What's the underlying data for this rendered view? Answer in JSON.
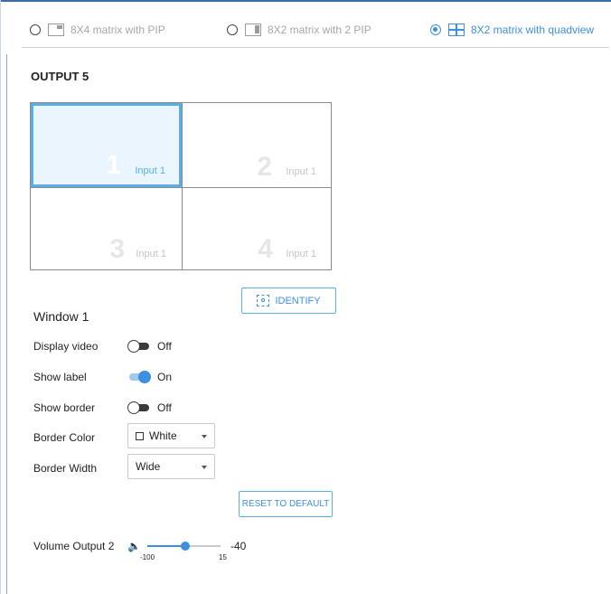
{
  "layout_modes": [
    {
      "label": "8X4 matrix with PIP",
      "selected": false
    },
    {
      "label": "8X2 matrix with 2 PIP",
      "selected": false
    },
    {
      "label": "8X2 matrix with quadview",
      "selected": true
    }
  ],
  "output": {
    "title": "OUTPUT 5"
  },
  "quadview": {
    "windows": [
      {
        "number": "1",
        "input": "Input 1",
        "selected": true
      },
      {
        "number": "2",
        "input": "Input 1",
        "selected": false
      },
      {
        "number": "3",
        "input": "Input 1",
        "selected": false
      },
      {
        "number": "4",
        "input": "Input 1",
        "selected": false
      }
    ]
  },
  "identify_button": {
    "label": "IDENTIFY"
  },
  "window_settings": {
    "title": "Window 1",
    "display_video": {
      "label": "Display video",
      "state": "Off"
    },
    "show_label": {
      "label": "Show label",
      "state": "On"
    },
    "show_border": {
      "label": "Show border",
      "state": "Off"
    },
    "border_color": {
      "label": "Border Color",
      "value": "White"
    },
    "border_width": {
      "label": "Border Width",
      "value": "Wide"
    }
  },
  "reset_button": {
    "label": "RESET TO DEFAULT"
  },
  "volume": {
    "label": "Volume Output 2",
    "min_label": "-100",
    "max_label": "15",
    "min": -100,
    "max": 15,
    "value": -40,
    "value_text": "-40"
  },
  "colors": {
    "accent": "#3d8fe0",
    "selected_cell_bg": "#eaf5fd"
  }
}
